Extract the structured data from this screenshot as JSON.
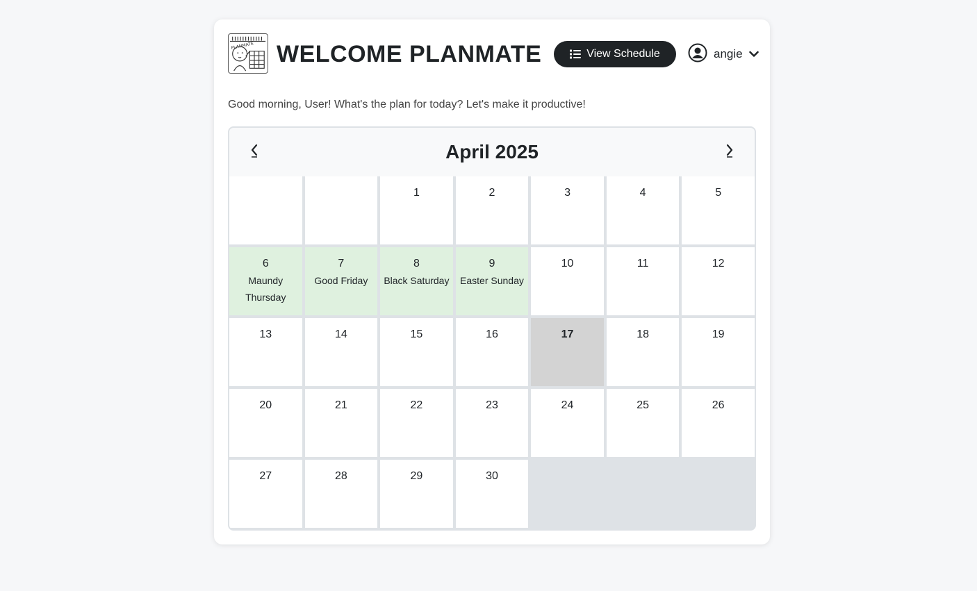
{
  "header": {
    "title": "WELCOME PLANMATE",
    "view_schedule_label": "View Schedule",
    "user_name": "angie"
  },
  "greeting": "Good morning, User! What's the plan for today? Let's make it productive!",
  "calendar": {
    "month_title": "April 2025",
    "prev_label": "‹",
    "next_label": "›",
    "weeks": [
      [
        {
          "day": ""
        },
        {
          "day": ""
        },
        {
          "day": "1"
        },
        {
          "day": "2"
        },
        {
          "day": "3"
        },
        {
          "day": "4"
        },
        {
          "day": "5"
        }
      ],
      [
        {
          "day": "6",
          "holiday": "Maundy Thursday"
        },
        {
          "day": "7",
          "holiday": "Good Friday"
        },
        {
          "day": "8",
          "holiday": "Black Saturday"
        },
        {
          "day": "9",
          "holiday": "Easter Sunday"
        },
        {
          "day": "10"
        },
        {
          "day": "11"
        },
        {
          "day": "12"
        }
      ],
      [
        {
          "day": "13"
        },
        {
          "day": "14"
        },
        {
          "day": "15"
        },
        {
          "day": "16"
        },
        {
          "day": "17",
          "today": true
        },
        {
          "day": "18"
        },
        {
          "day": "19"
        }
      ],
      [
        {
          "day": "20"
        },
        {
          "day": "21"
        },
        {
          "day": "22"
        },
        {
          "day": "23"
        },
        {
          "day": "24"
        },
        {
          "day": "25"
        },
        {
          "day": "26"
        }
      ],
      [
        {
          "day": "27"
        },
        {
          "day": "28"
        },
        {
          "day": "29"
        },
        {
          "day": "30"
        },
        {
          "filler": true
        },
        {
          "filler": true
        },
        {
          "filler": true
        }
      ]
    ]
  },
  "colors": {
    "primary_dark": "#1f2326",
    "holiday_bg": "#dff1df",
    "today_bg": "#d3d3d3",
    "grid_gap": "#dee2e6"
  },
  "icons": {
    "logo": "planmate-logo-icon",
    "schedule": "list-icon",
    "user": "user-circle-icon",
    "dropdown": "chevron-down-icon",
    "prev": "chevron-left-icon",
    "next": "chevron-right-icon"
  }
}
